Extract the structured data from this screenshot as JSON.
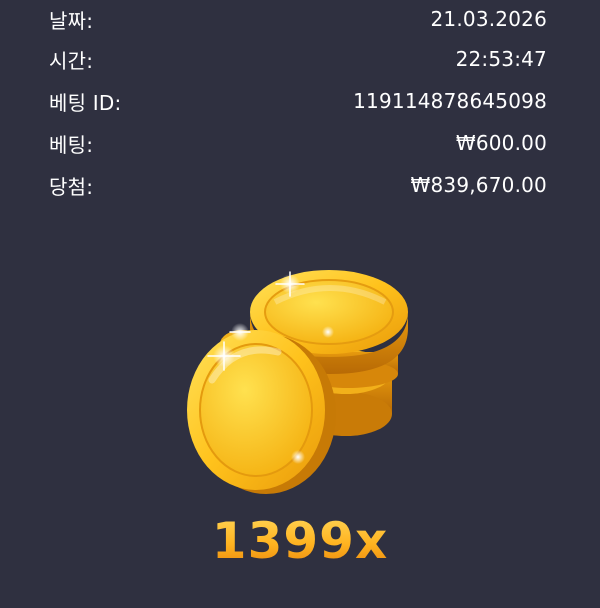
{
  "details": [
    {
      "label": "날짜:",
      "value": "21.03.2026"
    },
    {
      "label": "시간:",
      "value": "22:53:47"
    },
    {
      "label": "베팅 ID:",
      "value": "119114878645098"
    },
    {
      "label": "베팅:",
      "value": "₩600.00"
    },
    {
      "label": "당첨:",
      "value": "₩839,670.00"
    }
  ],
  "result": {
    "multiplier": "1399x",
    "icon": "gold-coins-icon"
  },
  "colors": {
    "background": "#2f3040",
    "text": "#ffffff",
    "gold": "#f9b42a"
  }
}
